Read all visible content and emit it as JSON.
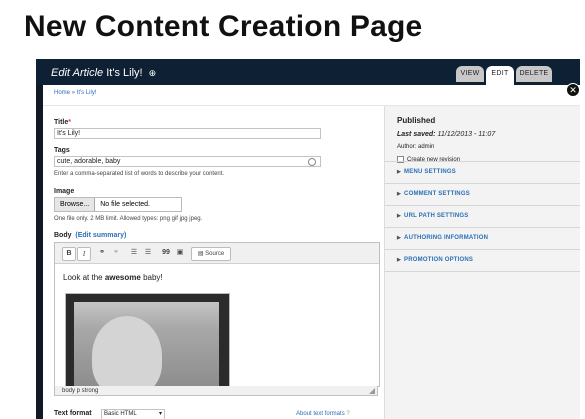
{
  "heading": "New Content Creation Page",
  "admin": {
    "edit_prefix": "Edit Article",
    "edit_title": "It's Lily!",
    "title_icon": "circle-plus",
    "tabs": [
      "VIEW",
      "EDIT",
      "DELETE"
    ],
    "close_icon": "close-x",
    "breadcrumb": {
      "home": "Home",
      "sep": "»",
      "current": "It's Lily!"
    }
  },
  "form": {
    "title_label": "Title",
    "title_required": "*",
    "title_value": "It's Lily!",
    "tags_label": "Tags",
    "tags_value": "cute, adorable, baby",
    "tags_desc": "Enter a comma-separated list of words to describe your content.",
    "image_label": "Image",
    "browse_label": "Browse...",
    "file_status": "No file selected.",
    "image_desc": "One file only. 2 MB limit. Allowed types: png gif jpg jpeg.",
    "body_label": "Body",
    "edit_summary": "(Edit summary)",
    "toolbar": {
      "bold": "B",
      "italic": "I",
      "quote": "99",
      "source": "Source"
    },
    "body_text_prefix": "Look at the ",
    "body_text_bold": "awesome",
    "body_text_suffix": " baby!",
    "path_bar": "body   p   strong",
    "text_format_label": "Text format",
    "text_format_value": "Basic HTML",
    "about_formats": "About text formats"
  },
  "sidebar": {
    "status": "Published",
    "last_saved_label": "Last saved:",
    "last_saved_value": "11/12/2013 - 11:07",
    "author": "Author: admin",
    "revision_label": "Create new revision",
    "sections": [
      "MENU SETTINGS",
      "COMMENT SETTINGS",
      "URL PATH SETTINGS",
      "AUTHORING INFORMATION",
      "PROMOTION OPTIONS"
    ]
  },
  "colors": {
    "topbar": "#0d2034",
    "link": "#2a6fb5",
    "sidebar": "#f3f3f3"
  }
}
